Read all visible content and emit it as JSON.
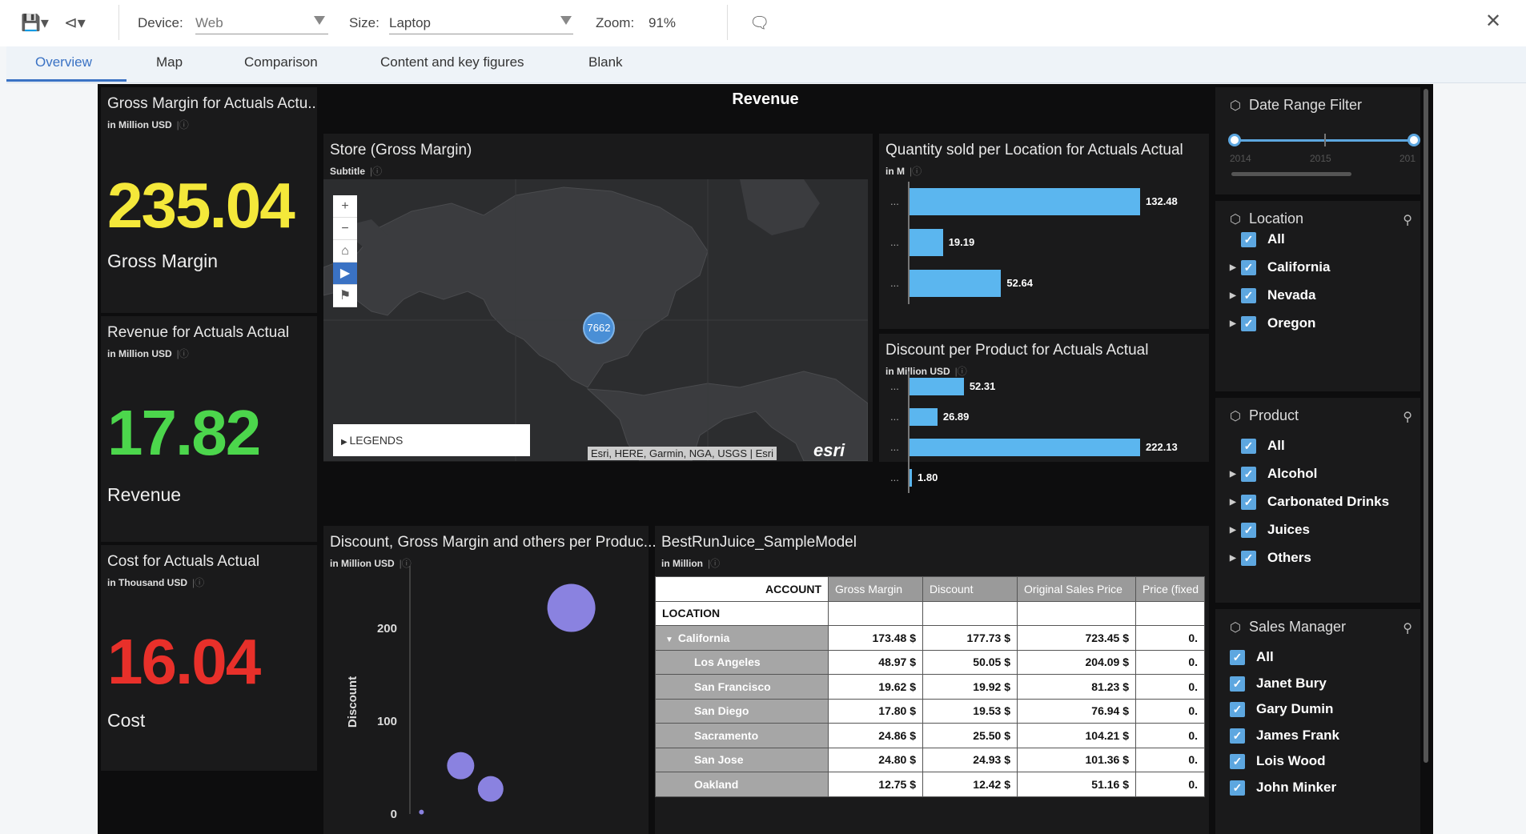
{
  "toolbar": {
    "save_icon": "save-icon",
    "share_icon": "share-icon",
    "device_label": "Device:",
    "device_value": "Web",
    "size_label": "Size:",
    "size_value": "Laptop",
    "zoom_label": "Zoom:",
    "zoom_value": "91%",
    "comment_icon": "comment-icon",
    "close_icon": "close-icon"
  },
  "tabs": [
    {
      "label": "Overview",
      "active": true
    },
    {
      "label": "Map",
      "active": false
    },
    {
      "label": "Comparison",
      "active": false
    },
    {
      "label": "Content and key figures",
      "active": false
    },
    {
      "label": "Blank",
      "active": false
    }
  ],
  "dashboard": {
    "title": "Revenue"
  },
  "kpis": [
    {
      "title": "Gross Margin for Actuals Actu..",
      "subtitle": "in Million USD",
      "value": "235.04",
      "label": "Gross Margin",
      "color": "#f4e83a"
    },
    {
      "title": "Revenue for Actuals Actual",
      "subtitle": "in Million USD",
      "value": "17.82",
      "label": "Revenue",
      "color": "#4cd64c"
    },
    {
      "title": "Cost for Actuals Actual",
      "subtitle": "in Thousand USD",
      "value": "16.04",
      "label": "Cost",
      "color": "#e8302a"
    }
  ],
  "map": {
    "title": "Store (Gross Margin)",
    "subtitle": "Subtitle",
    "cluster_count": "7662",
    "legends_label": "LEGENDS",
    "attribution": "Esri, HERE, Garmin, NGA, USGS | Esri",
    "logo": "esri",
    "controls": [
      "zoom-in-icon",
      "zoom-out-icon",
      "home-icon",
      "play-icon",
      "bookmark-icon"
    ]
  },
  "qty_chart": {
    "title": "Quantity sold per Location for Actuals Actual",
    "subtitle": "in M",
    "chart_data": {
      "type": "bar",
      "orientation": "horizontal",
      "categories": [
        "...",
        "...",
        "..."
      ],
      "values": [
        132.48,
        19.19,
        52.64
      ],
      "value_labels": [
        "132.48",
        "19.19",
        "52.64"
      ]
    }
  },
  "discount_chart": {
    "title": "Discount per Product for Actuals Actual",
    "subtitle": "in Million USD",
    "chart_data": {
      "type": "bar",
      "orientation": "horizontal",
      "categories": [
        "...",
        "...",
        "...",
        "..."
      ],
      "values": [
        52.31,
        26.89,
        222.13,
        1.8
      ],
      "value_labels": [
        "52.31",
        "26.89",
        "222.13",
        "1.80"
      ]
    }
  },
  "bubble_chart": {
    "title": "Discount, Gross Margin and others per Produc...",
    "subtitle": "in Million USD",
    "chart_data": {
      "type": "scatter",
      "ylabel": "Discount",
      "yticks": [
        "200",
        "100",
        "0"
      ],
      "ylim": [
        0,
        250
      ],
      "points": [
        {
          "x": 0.7,
          "y": 222,
          "size": 60
        },
        {
          "x": 0.22,
          "y": 52,
          "size": 34
        },
        {
          "x": 0.35,
          "y": 27,
          "size": 32
        },
        {
          "x": 0.05,
          "y": 2,
          "size": 6
        }
      ]
    }
  },
  "table": {
    "title": "BestRunJuice_SampleModel",
    "subtitle": "in Million",
    "account_header": "ACCOUNT",
    "location_header": "LOCATION",
    "columns": [
      "Gross Margin",
      "Discount",
      "Original Sales Price",
      "Price (fixed"
    ],
    "rows": [
      {
        "label": "California",
        "expanded": true,
        "values": [
          "173.48 $",
          "177.73 $",
          "723.45 $",
          "0."
        ]
      },
      {
        "label": "Los Angeles",
        "values": [
          "48.97 $",
          "50.05 $",
          "204.09 $",
          "0."
        ]
      },
      {
        "label": "San Francisco",
        "values": [
          "19.62 $",
          "19.92 $",
          "81.23 $",
          "0."
        ]
      },
      {
        "label": "San Diego",
        "values": [
          "17.80 $",
          "19.53 $",
          "76.94 $",
          "0."
        ]
      },
      {
        "label": "Sacramento",
        "values": [
          "24.86 $",
          "25.50 $",
          "104.21 $",
          "0."
        ]
      },
      {
        "label": "San Jose",
        "values": [
          "24.80 $",
          "24.93 $",
          "101.36 $",
          "0."
        ]
      },
      {
        "label": "Oakland",
        "values": [
          "12.75 $",
          "12.42 $",
          "51.16 $",
          "0."
        ]
      }
    ]
  },
  "filters": {
    "date_range": {
      "title": "Date Range Filter",
      "ticks": [
        "2014",
        "2015",
        "201"
      ]
    },
    "location": {
      "title": "Location",
      "items": [
        {
          "label": "All",
          "expandable": false
        },
        {
          "label": "California",
          "expandable": true
        },
        {
          "label": "Nevada",
          "expandable": true
        },
        {
          "label": "Oregon",
          "expandable": true
        }
      ]
    },
    "product": {
      "title": "Product",
      "items": [
        {
          "label": "All",
          "expandable": false
        },
        {
          "label": "Alcohol",
          "expandable": true
        },
        {
          "label": "Carbonated Drinks",
          "expandable": true
        },
        {
          "label": "Juices",
          "expandable": true
        },
        {
          "label": "Others",
          "expandable": true
        }
      ]
    },
    "sales_manager": {
      "title": "Sales Manager",
      "items": [
        {
          "label": "All"
        },
        {
          "label": "Janet Bury"
        },
        {
          "label": "Gary Dumin"
        },
        {
          "label": "James Frank"
        },
        {
          "label": "Lois Wood"
        },
        {
          "label": "John Minker"
        }
      ]
    }
  }
}
